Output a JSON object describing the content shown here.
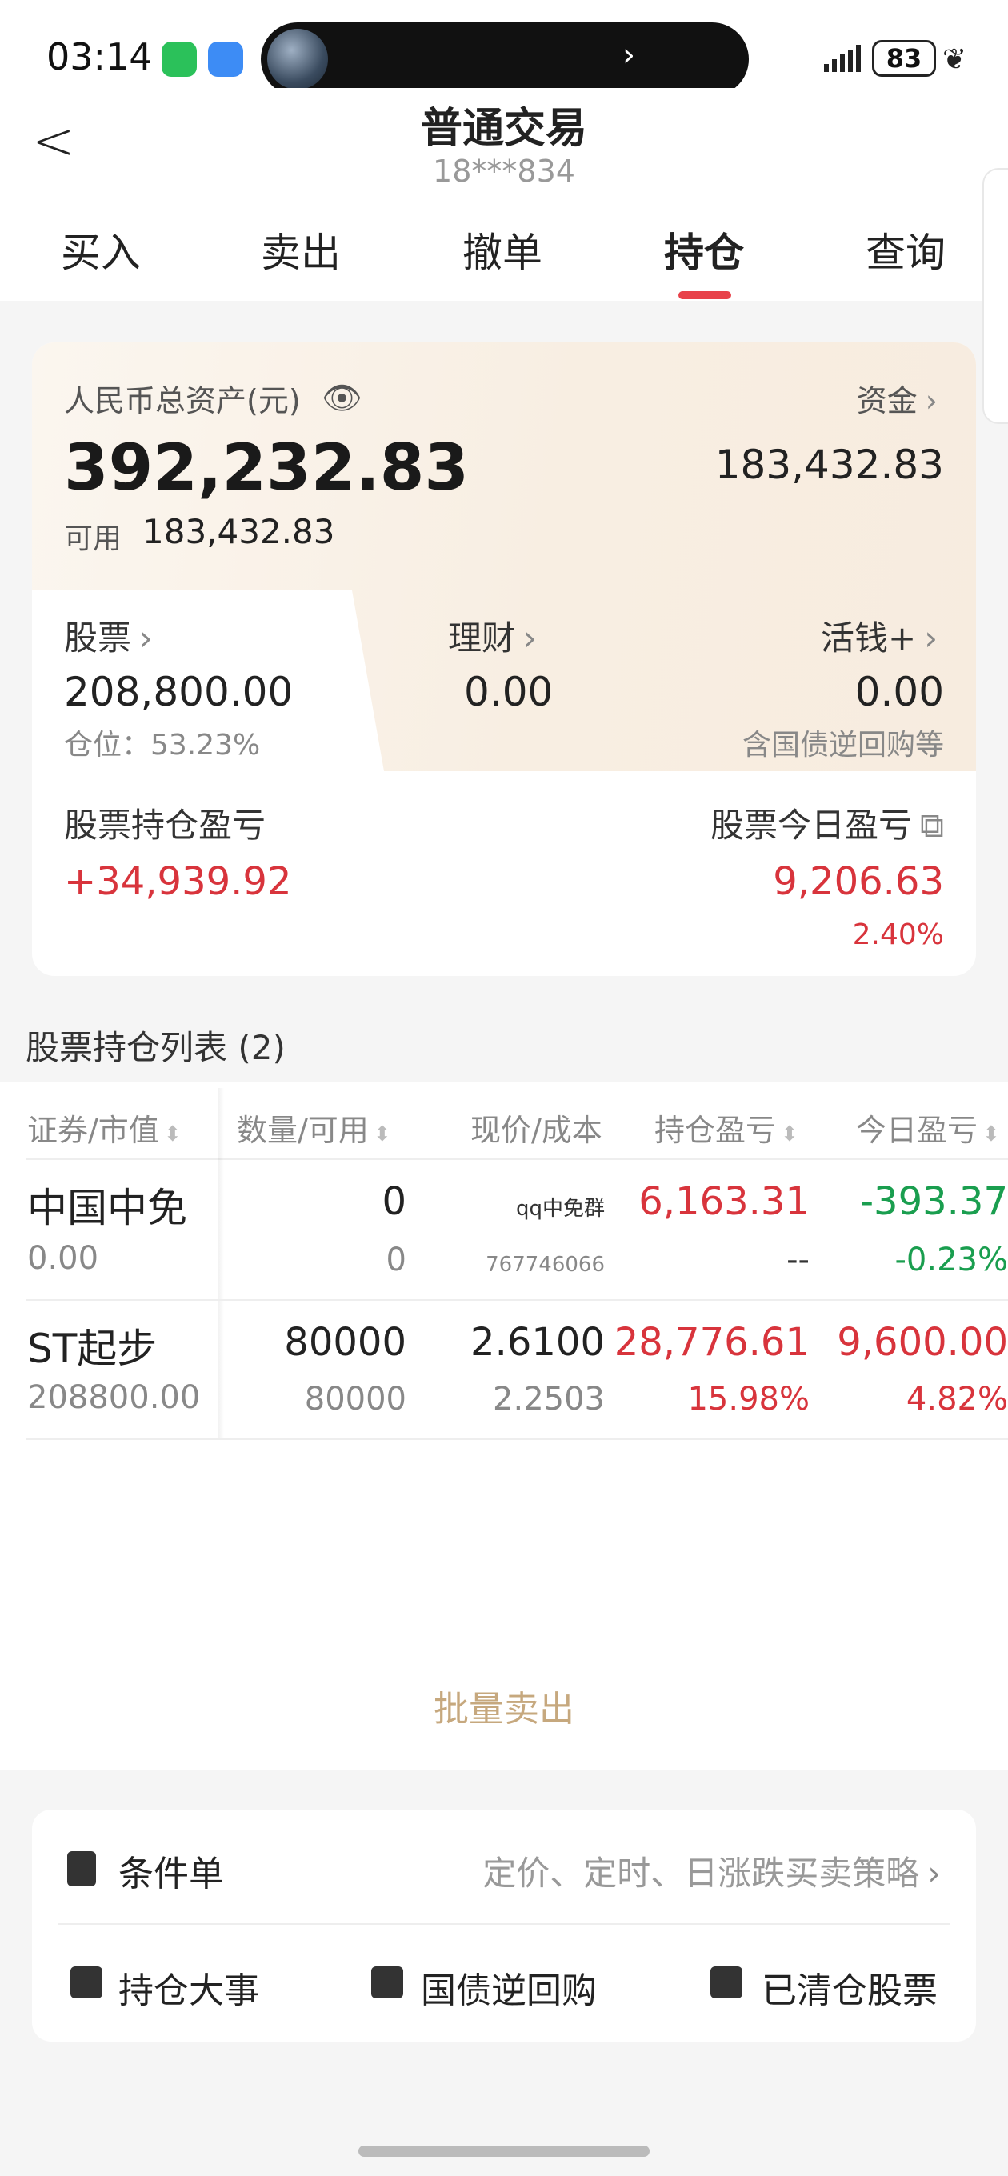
{
  "status_bar": {
    "time": "03:14",
    "battery": "83"
  },
  "header": {
    "title": "普通交易",
    "account": "18***834"
  },
  "tabs": [
    {
      "label": "买入"
    },
    {
      "label": "卖出"
    },
    {
      "label": "撤单"
    },
    {
      "label": "持仓",
      "active": true
    },
    {
      "label": "查询"
    }
  ],
  "asset": {
    "total_label": "人民币总资产(元)",
    "total_value": "392,232.83",
    "available_label": "可用",
    "available_value": "183,432.83",
    "fund_label": "资金",
    "fund_value": "183,432.83",
    "stock_label": "股票",
    "stock_value": "208,800.00",
    "position_ratio": "仓位：53.23%",
    "licai_label": "理财",
    "licai_value": "0.00",
    "huoqian_label": "活钱+",
    "huoqian_value": "0.00",
    "huoqian_note": "含国债逆回购等",
    "holding_pl_label": "股票持仓盈亏",
    "holding_pl_value": "+34,939.92",
    "today_pl_label": "股票今日盈亏",
    "today_pl_value": "9,206.63",
    "today_pl_pct": "2.40%"
  },
  "holdings": {
    "title": "股票持仓列表 (2)",
    "columns": [
      "证券/市值",
      "数量/可用",
      "现价/成本",
      "持仓盈亏",
      "今日盈亏"
    ],
    "rows": [
      {
        "name": "中国中免",
        "market_value": "0.00",
        "qty": "0",
        "avail": "0",
        "price": "qq中免群",
        "cost": "767746066",
        "pl": "6,163.31",
        "pl_pct": "--",
        "today": "-393.37",
        "today_pct": "-0.23%"
      },
      {
        "name": "ST起步",
        "market_value": "208800.00",
        "qty": "80000",
        "avail": "80000",
        "price": "2.6100",
        "cost": "2.2503",
        "pl": "28,776.61",
        "pl_pct": "15.98%",
        "today": "9,600.00",
        "today_pct": "4.82%"
      }
    ],
    "batch_sell": "批量卖出"
  },
  "bottom": {
    "condition_label": "条件单",
    "condition_desc": "定价、定时、日涨跌买卖策略",
    "items": [
      "持仓大事",
      "国债逆回购",
      "已清仓股票"
    ]
  },
  "colors": {
    "up": "#d8343c",
    "down": "#1a9e4f",
    "accent": "#e8424a",
    "gold": "#c6a87e"
  }
}
